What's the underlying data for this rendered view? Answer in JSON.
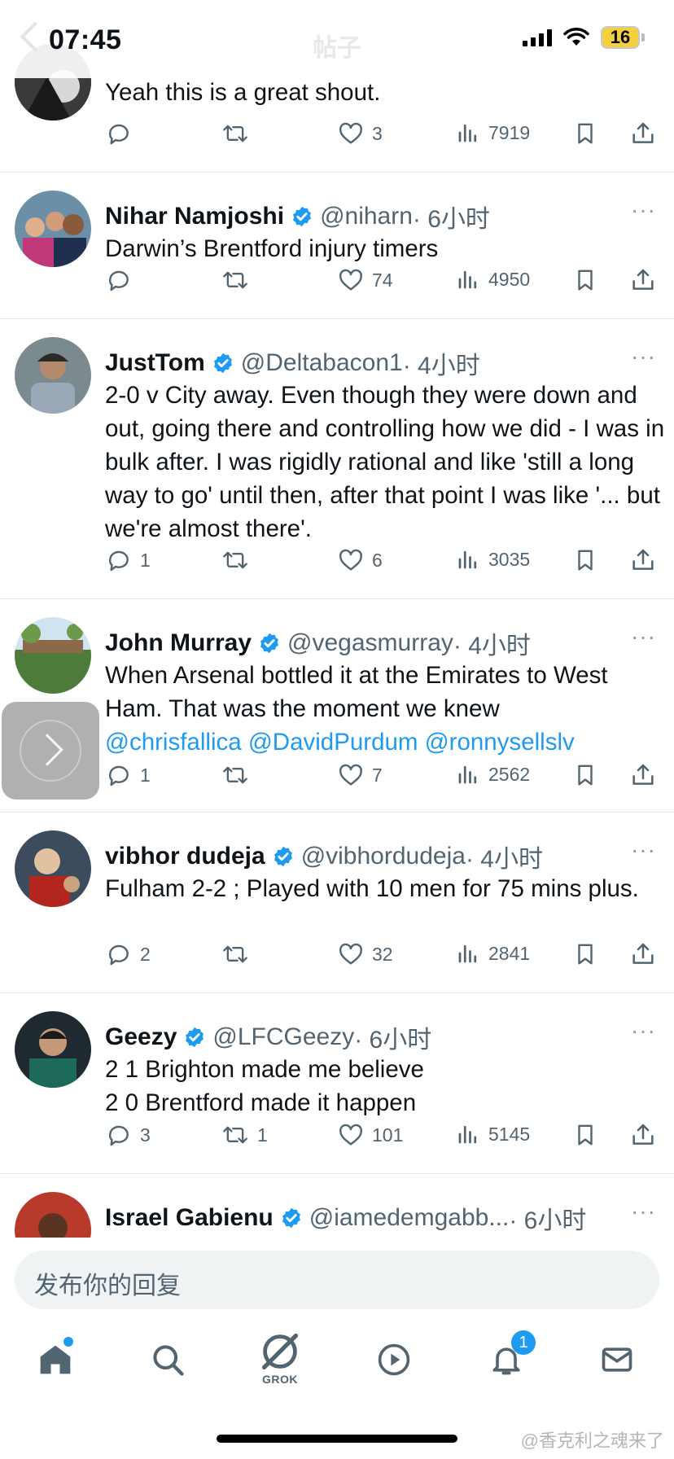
{
  "status": {
    "time": "07:45",
    "battery": "16",
    "ghost_title": "帖子"
  },
  "tweets": [
    {
      "text": "Yeah this is a great shout.",
      "replies": "",
      "retweets": "",
      "likes": "3",
      "views": "7919"
    },
    {
      "name": "Nihar Namjoshi",
      "handle": "@niharn",
      "time": "· 6小时",
      "text": "Darwin’s Brentford injury timers",
      "replies": "",
      "retweets": "",
      "likes": "74",
      "views": "4950"
    },
    {
      "name": "JustTom",
      "handle": "@Deltabacon1",
      "time": "· 4小时",
      "text": "2-0 v City away. Even though they were down and out, going there and controlling how we did - I was in bulk after. I was rigidly rational and like 'still a long way to go' until then, after that point I was like '... but we're almost there'.",
      "replies": "1",
      "retweets": "",
      "likes": "6",
      "views": "3035"
    },
    {
      "name": "John Murray",
      "handle": "@vegasmurray",
      "time": "· 4小时",
      "text": "When Arsenal bottled it at the Emirates to West Ham. That was the moment we knew",
      "mentions": "@chrisfallica @DavidPurdum @ronnysellslv",
      "replies": "1",
      "retweets": "",
      "likes": "7",
      "views": "2562"
    },
    {
      "name": "vibhor dudeja",
      "handle": "@vibhordudeja",
      "time": "· 4小时",
      "text": "Fulham 2-2 ; Played with 10 men for 75 mins plus.",
      "replies": "2",
      "retweets": "",
      "likes": "32",
      "views": "2841"
    },
    {
      "name": "Geezy",
      "handle": "@LFCGeezy",
      "time": "· 6小时",
      "text_line1": "2 1 Brighton made me believe",
      "text_line2": "2 0 Brentford made it happen",
      "replies": "3",
      "retweets": "1",
      "likes": "101",
      "views": "5145"
    },
    {
      "name": "Israel Gabienu",
      "handle": "@iamedemgabb...",
      "time": "· 6小时"
    }
  ],
  "more_label": "···",
  "reply_placeholder": "发布你的回复",
  "nav": {
    "grok_label": "GROK",
    "notifications_badge": "1"
  },
  "watermark": "@香克利之魂来了",
  "colors": {
    "accent": "#1d9bf0",
    "secondary_text": "#536471"
  }
}
